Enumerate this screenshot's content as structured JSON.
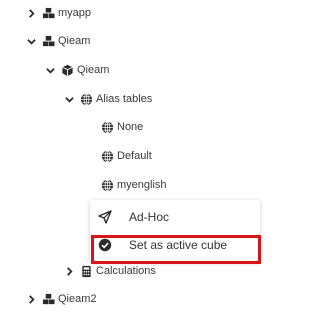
{
  "tree": {
    "myapp": {
      "label": "myapp",
      "expanded": false,
      "icon": "cubes-icon"
    },
    "qieam": {
      "label": "Qieam",
      "expanded": true,
      "icon": "cubes-icon"
    },
    "qieam_cube": {
      "label": "Qieam",
      "expanded": true,
      "icon": "cube-icon"
    },
    "alias_tables": {
      "label": "Alias tables",
      "expanded": true,
      "icon": "globe-icon"
    },
    "aliases": [
      {
        "label": "None",
        "icon": "globe-icon"
      },
      {
        "label": "Default",
        "icon": "globe-icon"
      },
      {
        "label": "myenglish",
        "icon": "globe-icon"
      }
    ],
    "calculations": {
      "label": "Calculations",
      "expanded": false,
      "icon": "calculator-icon"
    },
    "qieam2": {
      "label": "Qieam2",
      "expanded": false,
      "icon": "cubes-icon"
    }
  },
  "context_menu": {
    "items": [
      {
        "label": "Ad-Hoc",
        "icon": "send-icon"
      },
      {
        "label": "Set as active cube",
        "icon": "check-circle-icon",
        "highlighted": true
      }
    ]
  },
  "colors": {
    "icon": "#2b2b2b",
    "highlight_border": "#d9131b",
    "text": "#333333"
  }
}
